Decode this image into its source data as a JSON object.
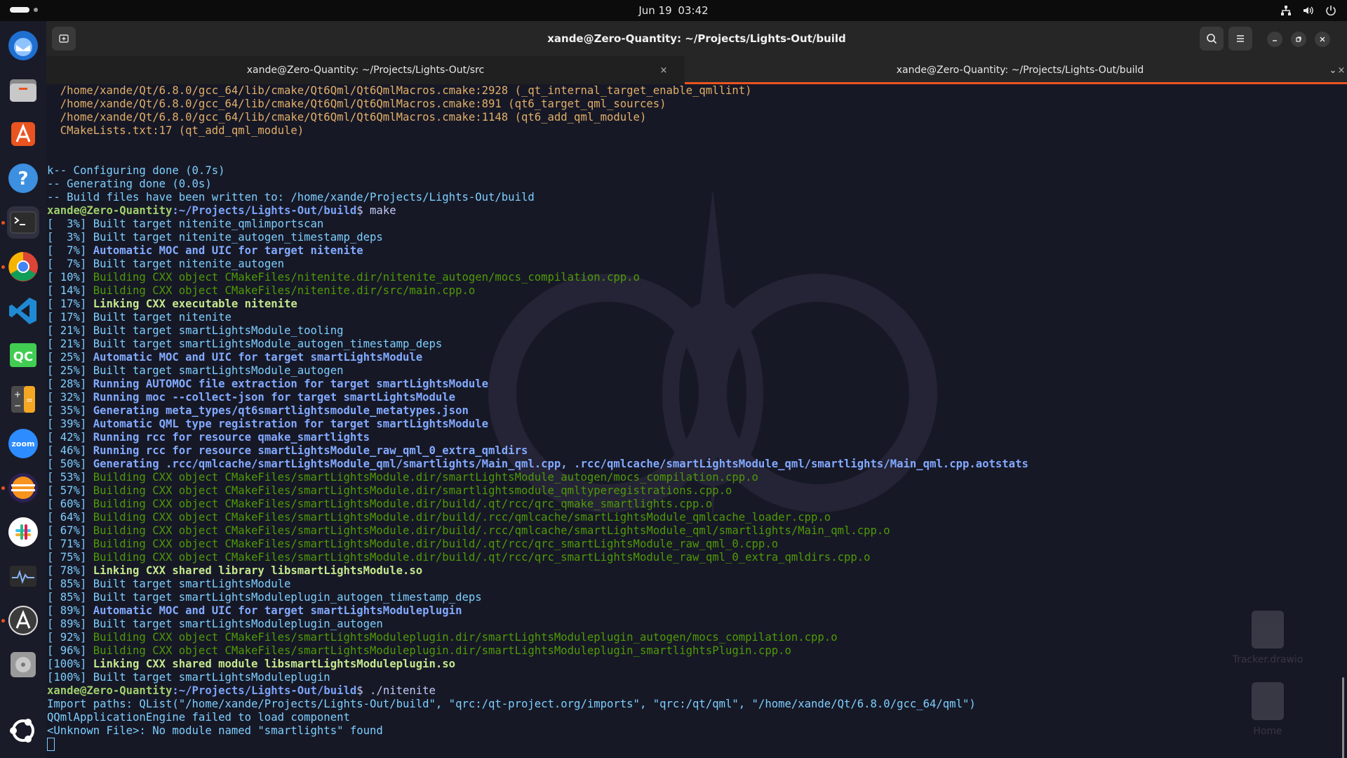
{
  "topbar": {
    "date": "Jun 19",
    "time": "03:42",
    "tray_icons": [
      "network-icon",
      "volume-icon",
      "power-icon"
    ]
  },
  "dock": {
    "items": [
      {
        "name": "thunderbird",
        "icon": "thunderbird-icon"
      },
      {
        "name": "files",
        "icon": "files-icon"
      },
      {
        "name": "app-center",
        "icon": "app-center-icon"
      },
      {
        "name": "help",
        "icon": "help-icon"
      },
      {
        "name": "terminal",
        "icon": "terminal-icon",
        "active": true
      },
      {
        "name": "chrome",
        "icon": "chrome-icon"
      },
      {
        "name": "vscode",
        "icon": "vscode-icon"
      },
      {
        "name": "qt-creator",
        "icon": "qt-creator-icon",
        "label": "QC"
      },
      {
        "name": "calculator",
        "icon": "calculator-icon"
      },
      {
        "name": "zoom",
        "icon": "zoom-icon",
        "label": "zoom"
      },
      {
        "name": "eclipse",
        "icon": "eclipse-icon"
      },
      {
        "name": "slack",
        "icon": "slack-icon"
      },
      {
        "name": "system-monitor",
        "icon": "system-monitor-icon"
      },
      {
        "name": "software-updater",
        "icon": "software-updater-icon"
      },
      {
        "name": "disk",
        "icon": "disk-icon"
      },
      {
        "name": "ubuntu",
        "icon": "ubuntu-icon"
      }
    ]
  },
  "window": {
    "title": "xande@Zero-Quantity: ~/Projects/Lights-Out/build",
    "tabs": [
      {
        "label": "xande@Zero-Quantity: ~/Projects/Lights-Out/src",
        "active": false
      },
      {
        "label": "xande@Zero-Quantity: ~/Projects/Lights-Out/build",
        "active": true
      }
    ],
    "tab_close_glyph": "×",
    "tab_menu_glyph": "⌄"
  },
  "terminal": {
    "lines": [
      {
        "cls": "c-yellow",
        "text": "  /home/xande/Qt/6.8.0/gcc_64/lib/cmake/Qt6Qml/Qt6QmlMacros.cmake:2928 (_qt_internal_target_enable_qmllint)"
      },
      {
        "cls": "c-yellow",
        "text": "  /home/xande/Qt/6.8.0/gcc_64/lib/cmake/Qt6Qml/Qt6QmlMacros.cmake:891 (qt6_target_qml_sources)"
      },
      {
        "cls": "c-yellow",
        "text": "  /home/xande/Qt/6.8.0/gcc_64/lib/cmake/Qt6Qml/Qt6QmlMacros.cmake:1148 (qt6_add_qml_module)"
      },
      {
        "cls": "c-yellow",
        "text": "  CMakeLists.txt:17 (qt_add_qml_module)"
      },
      {
        "cls": "c-normal",
        "text": ""
      },
      {
        "cls": "c-normal",
        "text": ""
      },
      {
        "cls": "c-cyan",
        "text": "k-- Configuring done (0.7s)"
      },
      {
        "cls": "c-cyan",
        "text": "-- Generating done (0.0s)"
      },
      {
        "cls": "c-cyan",
        "text": "-- Build files have been written to: /home/xande/Projects/Lights-Out/build"
      },
      {
        "type": "prompt",
        "user": "xande@Zero-Quantity",
        "path": ":~/Projects/Lights-Out/build",
        "cmd": "$ make"
      },
      {
        "cls": "c-normal",
        "pre": "[  3%] ",
        "post_cls": "c-normal",
        "text": "Built target nitenite_qmlimportscan"
      },
      {
        "cls": "c-normal",
        "pre": "[  3%] ",
        "post_cls": "c-normal",
        "text": "Built target nitenite_autogen_timestamp_deps"
      },
      {
        "cls": "c-normal",
        "pre": "[  7%] ",
        "post_cls": "c-blue",
        "text": "Automatic MOC and UIC for target nitenite"
      },
      {
        "cls": "c-normal",
        "pre": "[  7%] ",
        "post_cls": "c-normal",
        "text": "Built target nitenite_autogen"
      },
      {
        "cls": "c-normal",
        "pre": "[ 10%] ",
        "post_cls": "c-darkgreen",
        "text": "Building CXX object CMakeFiles/nitenite.dir/nitenite_autogen/mocs_compilation.cpp.o"
      },
      {
        "cls": "c-normal",
        "pre": "[ 14%] ",
        "post_cls": "c-darkgreen",
        "text": "Building CXX object CMakeFiles/nitenite.dir/src/main.cpp.o"
      },
      {
        "cls": "c-normal",
        "pre": "[ 17%] ",
        "post_cls": "c-boldlime",
        "text": "Linking CXX executable nitenite"
      },
      {
        "cls": "c-normal",
        "pre": "[ 17%] ",
        "post_cls": "c-normal",
        "text": "Built target nitenite"
      },
      {
        "cls": "c-normal",
        "pre": "[ 21%] ",
        "post_cls": "c-normal",
        "text": "Built target smartLightsModule_tooling"
      },
      {
        "cls": "c-normal",
        "pre": "[ 21%] ",
        "post_cls": "c-normal",
        "text": "Built target smartLightsModule_autogen_timestamp_deps"
      },
      {
        "cls": "c-normal",
        "pre": "[ 25%] ",
        "post_cls": "c-blue",
        "text": "Automatic MOC and UIC for target smartLightsModule"
      },
      {
        "cls": "c-normal",
        "pre": "[ 25%] ",
        "post_cls": "c-normal",
        "text": "Built target smartLightsModule_autogen"
      },
      {
        "cls": "c-normal",
        "pre": "[ 28%] ",
        "post_cls": "c-blue",
        "text": "Running AUTOMOC file extraction for target smartLightsModule"
      },
      {
        "cls": "c-normal",
        "pre": "[ 32%] ",
        "post_cls": "c-blue",
        "text": "Running moc --collect-json for target smartLightsModule"
      },
      {
        "cls": "c-normal",
        "pre": "[ 35%] ",
        "post_cls": "c-blue",
        "text": "Generating meta_types/qt6smartlightsmodule_metatypes.json"
      },
      {
        "cls": "c-normal",
        "pre": "[ 39%] ",
        "post_cls": "c-blue",
        "text": "Automatic QML type registration for target smartLightsModule"
      },
      {
        "cls": "c-normal",
        "pre": "[ 42%] ",
        "post_cls": "c-blue",
        "text": "Running rcc for resource qmake_smartlights"
      },
      {
        "cls": "c-normal",
        "pre": "[ 46%] ",
        "post_cls": "c-blue",
        "text": "Running rcc for resource smartLightsModule_raw_qml_0_extra_qmldirs"
      },
      {
        "cls": "c-normal",
        "pre": "[ 50%] ",
        "post_cls": "c-blue",
        "text": "Generating .rcc/qmlcache/smartLightsModule_qml/smartlights/Main_qml.cpp, .rcc/qmlcache/smartLightsModule_qml/smartlights/Main_qml.cpp.aotstats"
      },
      {
        "cls": "c-normal",
        "pre": "[ 53%] ",
        "post_cls": "c-darkgreen",
        "text": "Building CXX object CMakeFiles/smartLightsModule.dir/smartLightsModule_autogen/mocs_compilation.cpp.o"
      },
      {
        "cls": "c-normal",
        "pre": "[ 57%] ",
        "post_cls": "c-darkgreen",
        "text": "Building CXX object CMakeFiles/smartLightsModule.dir/smartlightsmodule_qmltyperegistrations.cpp.o"
      },
      {
        "cls": "c-normal",
        "pre": "[ 60%] ",
        "post_cls": "c-darkgreen",
        "text": "Building CXX object CMakeFiles/smartLightsModule.dir/build/.qt/rcc/qrc_qmake_smartlights.cpp.o"
      },
      {
        "cls": "c-normal",
        "pre": "[ 64%] ",
        "post_cls": "c-darkgreen",
        "text": "Building CXX object CMakeFiles/smartLightsModule.dir/build/.rcc/qmlcache/smartLightsModule_qmlcache_loader.cpp.o"
      },
      {
        "cls": "c-normal",
        "pre": "[ 67%] ",
        "post_cls": "c-darkgreen",
        "text": "Building CXX object CMakeFiles/smartLightsModule.dir/build/.rcc/qmlcache/smartLightsModule_qml/smartlights/Main_qml.cpp.o"
      },
      {
        "cls": "c-normal",
        "pre": "[ 71%] ",
        "post_cls": "c-darkgreen",
        "text": "Building CXX object CMakeFiles/smartLightsModule.dir/build/.qt/rcc/qrc_smartLightsModule_raw_qml_0.cpp.o"
      },
      {
        "cls": "c-normal",
        "pre": "[ 75%] ",
        "post_cls": "c-darkgreen",
        "text": "Building CXX object CMakeFiles/smartLightsModule.dir/build/.qt/rcc/qrc_smartLightsModule_raw_qml_0_extra_qmldirs.cpp.o"
      },
      {
        "cls": "c-normal",
        "pre": "[ 78%] ",
        "post_cls": "c-boldlime",
        "text": "Linking CXX shared library libsmartLightsModule.so"
      },
      {
        "cls": "c-normal",
        "pre": "[ 85%] ",
        "post_cls": "c-normal",
        "text": "Built target smartLightsModule"
      },
      {
        "cls": "c-normal",
        "pre": "[ 85%] ",
        "post_cls": "c-normal",
        "text": "Built target smartLightsModuleplugin_autogen_timestamp_deps"
      },
      {
        "cls": "c-normal",
        "pre": "[ 89%] ",
        "post_cls": "c-blue",
        "text": "Automatic MOC and UIC for target smartLightsModuleplugin"
      },
      {
        "cls": "c-normal",
        "pre": "[ 89%] ",
        "post_cls": "c-normal",
        "text": "Built target smartLightsModuleplugin_autogen"
      },
      {
        "cls": "c-normal",
        "pre": "[ 92%] ",
        "post_cls": "c-darkgreen",
        "text": "Building CXX object CMakeFiles/smartLightsModuleplugin.dir/smartLightsModuleplugin_autogen/mocs_compilation.cpp.o"
      },
      {
        "cls": "c-normal",
        "pre": "[ 96%] ",
        "post_cls": "c-darkgreen",
        "text": "Building CXX object CMakeFiles/smartLightsModuleplugin.dir/smartLightsModuleplugin_smartlightsPlugin.cpp.o"
      },
      {
        "cls": "c-normal",
        "pre": "[100%] ",
        "post_cls": "c-boldlime",
        "text": "Linking CXX shared module libsmartLightsModuleplugin.so"
      },
      {
        "cls": "c-normal",
        "pre": "[100%] ",
        "post_cls": "c-normal",
        "text": "Built target smartLightsModuleplugin"
      },
      {
        "type": "prompt",
        "user": "xande@Zero-Quantity",
        "path": ":~/Projects/Lights-Out/build",
        "cmd": "$ ./nitenite"
      },
      {
        "cls": "c-cyan",
        "text": "Import paths: QList(\"/home/xande/Projects/Lights-Out/build\", \"qrc:/qt-project.org/imports\", \"qrc:/qt/qml\", \"/home/xande/Qt/6.8.0/gcc_64/qml\")"
      },
      {
        "cls": "c-cyan",
        "text": "QQmlApplicationEngine failed to load component"
      },
      {
        "cls": "c-cyan",
        "text": "<Unknown File>: No module named \"smartlights\" found"
      },
      {
        "type": "cursor"
      }
    ]
  },
  "desktop": {
    "icons": [
      {
        "label": "Tracker.drawio",
        "icon": "file-icon"
      },
      {
        "label": "Home",
        "icon": "home-folder-icon"
      }
    ]
  },
  "colors": {
    "accent": "#e95420",
    "terminal_bg": "#171826",
    "prompt_user": "#9ece6a",
    "prompt_path": "#7aa2f7"
  }
}
